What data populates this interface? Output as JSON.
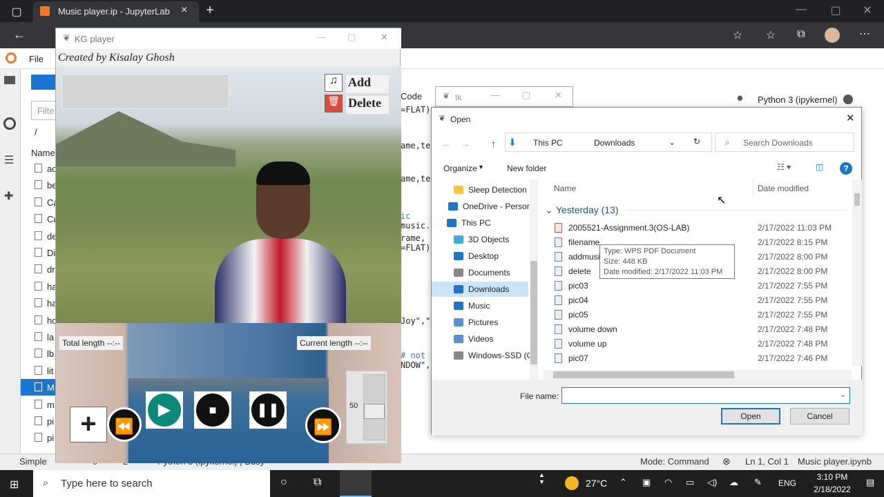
{
  "browser": {
    "tab_title": "Music player.ip - JupyterLab",
    "close": "×",
    "new_tab": "+"
  },
  "jupyter": {
    "menu_file": "File",
    "filter_placeholder": "Filte",
    "path": "/",
    "col_name": "Name",
    "files": [
      "ac",
      "be",
      "Ca",
      "Cu",
      "de",
      "Di",
      "dr",
      "ha",
      "ha",
      "ho",
      "la",
      "lb",
      "lit",
      "M",
      "m",
      "pi",
      "pi"
    ],
    "code_tab": "Code",
    "kernel": "Python 3 (ipykernel)",
    "code_lines": [
      "=FLAT)",
      "ame,tex",
      "ame,tex",
      "ic",
      "music.p",
      "rame, i",
      "=FLAT)",
      "Joy\",\"T",
      "# not",
      "NDOW\",c"
    ],
    "status": {
      "simple": "Simple",
      "mode": "Mode: Command",
      "pos": "Ln 1, Col 1",
      "file": "Music player.ipynb",
      "kernel_busy": "Python 3 (ipykernel) | Busy",
      "n1": "0",
      "n2": "2"
    }
  },
  "player": {
    "title": "KG player",
    "credit": "Created by Kisalay Ghosh",
    "add": "Add",
    "delete": "Delete",
    "total_length": "Total length --:--",
    "current_length": "Current length --:--",
    "volume": "50"
  },
  "tk": {
    "title": "tk"
  },
  "dialog": {
    "title": "Open",
    "crumbs": [
      "This PC",
      "Downloads"
    ],
    "search_placeholder": "Search Downloads",
    "organize": "Organize",
    "new_folder": "New folder",
    "col_name": "Name",
    "col_date": "Date modified",
    "group": "Yesterday (13)",
    "nav": [
      "Sleep Detection",
      "OneDrive - Persor",
      "This PC",
      "3D Objects",
      "Desktop",
      "Documents",
      "Downloads",
      "Music",
      "Pictures",
      "Videos",
      "Windows-SSD (C"
    ],
    "files": [
      {
        "name": "2005521-Assignment.3(OS-LAB)",
        "date": "2/17/2022 11:03 PM"
      },
      {
        "name": "filename",
        "date": "2/17/2022 8:15 PM"
      },
      {
        "name": "addmusic",
        "date": "2/17/2022 8:00 PM"
      },
      {
        "name": "delete",
        "date": "2/17/2022 8:00 PM"
      },
      {
        "name": "pic03",
        "date": "2/17/2022 7:55 PM"
      },
      {
        "name": "pic04",
        "date": "2/17/2022 7:55 PM"
      },
      {
        "name": "pic05",
        "date": "2/17/2022 7:55 PM"
      },
      {
        "name": "volume down",
        "date": "2/17/2022 7:48 PM"
      },
      {
        "name": "volume up",
        "date": "2/17/2022 7:48 PM"
      },
      {
        "name": "pic07",
        "date": "2/17/2022 7:46 PM"
      }
    ],
    "tooltip": {
      "type": "Type: WPS PDF Document",
      "size": "Size: 448 KB",
      "date": "Date modified: 2/17/2022 11:03 PM"
    },
    "filename_label": "File name:",
    "open": "Open",
    "cancel": "Cancel"
  },
  "taskbar": {
    "search": "Type here to search",
    "temp": "27°C",
    "lang": "ENG",
    "time": "3:10 PM",
    "date": "2/18/2022"
  }
}
